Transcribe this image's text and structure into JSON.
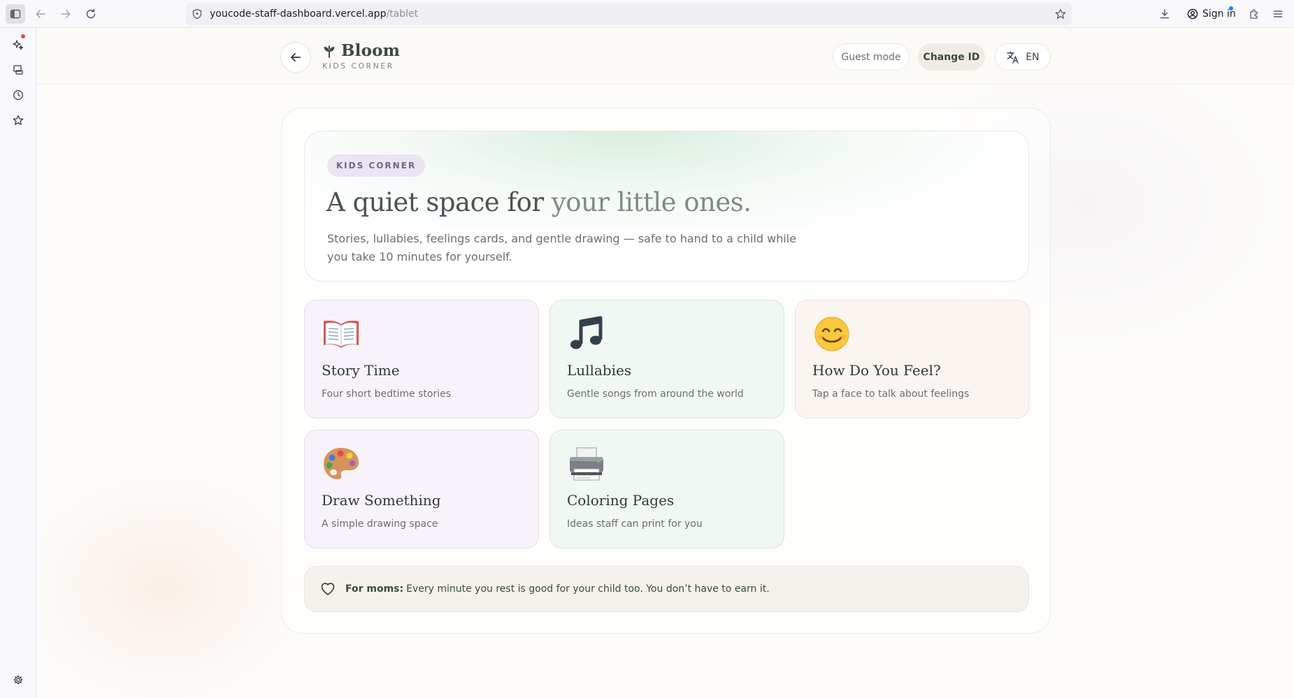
{
  "browser": {
    "url_host": "youcode-staff-dashboard.vercel.app",
    "url_path": "/tablet",
    "sign_in_label": "Sign in"
  },
  "header": {
    "brand_name": "Bloom",
    "brand_subtitle": "KIDS CORNER",
    "guest_mode_label": "Guest mode",
    "change_id_label": "Change ID",
    "language_label": "EN"
  },
  "hero": {
    "tag": "KIDS CORNER",
    "title_part1": "A quiet space for",
    "title_part2": "your little ones.",
    "description": "Stories, lullabies, feelings cards, and gentle drawing — safe to hand to a child while you take 10 minutes for yourself."
  },
  "cards": [
    {
      "title": "Story Time",
      "subtitle": "Four short bedtime stories",
      "icon": "open-book-icon"
    },
    {
      "title": "Lullabies",
      "subtitle": "Gentle songs from around the world",
      "icon": "music-note-icon"
    },
    {
      "title": "How Do You Feel?",
      "subtitle": "Tap a face to talk about feelings",
      "icon": "smiling-face-icon"
    },
    {
      "title": "Draw Something",
      "subtitle": "A simple drawing space",
      "icon": "palette-icon"
    },
    {
      "title": "Coloring Pages",
      "subtitle": "Ideas staff can print for you",
      "icon": "printer-icon"
    }
  ],
  "note": {
    "bold": "For moms:",
    "text": "Every minute you rest is good for your child too. You don’t have to earn it."
  },
  "colors": {
    "accent_green": "#3c4a40",
    "lavender_card": "#f8f3fa",
    "mint_card": "#f1f7f3",
    "peach_card": "#fbf5f2",
    "tag_bg": "#ebe4f3"
  }
}
